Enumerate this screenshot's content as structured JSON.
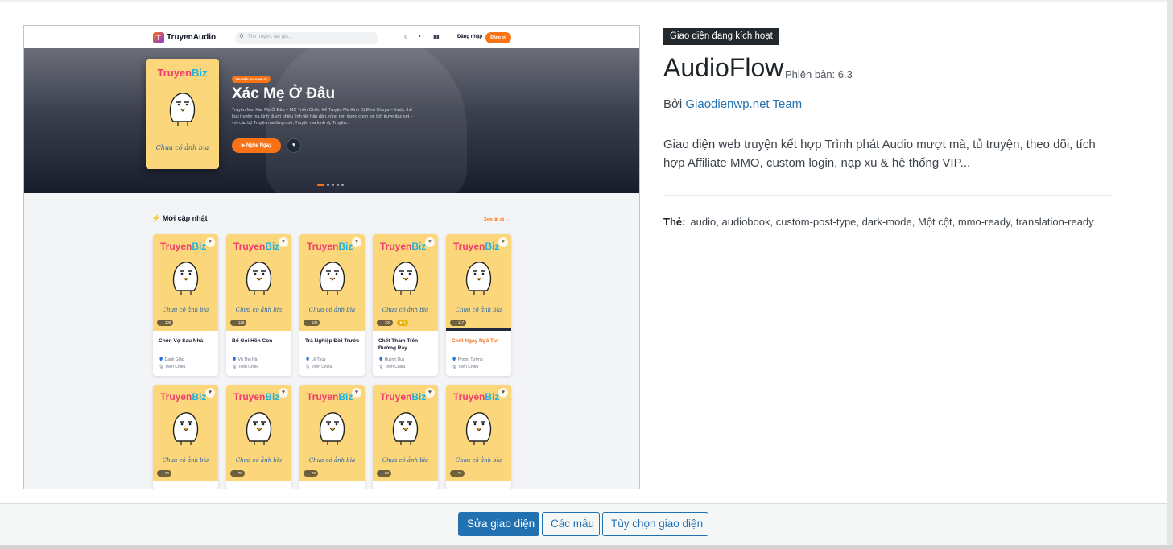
{
  "preview": {
    "site_brand": "TruyenAudio",
    "logo_letter": "T",
    "search_placeholder": "Tìm truyện, tác giả...",
    "login_label": "Đăng nhập",
    "register_label": "Đăng ký",
    "hero": {
      "badge": "TRUYỆN MA KINH DỊ",
      "title": "Xác Mẹ Ở Đâu",
      "description": "Truyện Ma: Xác Mẹ Ở Đâu – MC Triển Chiêu Kể Truyện Ma Kinh Dị Đêm Khuya – thuộc thể loại truyện ma kinh dị với nhiều tình tiết hấp dẫn, rùng rợn được chọn lọc bởi truyenbiz.net – với các bộ Truyện ma làng quê, Truyện ma kinh dị, Truyện...",
      "play_label": "Nghe Ngay",
      "cover_brand_a": "Truyen",
      "cover_brand_b": "Biz",
      "cover_caption": "Chưa có ảnh bìa"
    },
    "section_title": "Mới cập nhật",
    "see_all": "Xem tất cả",
    "cards": [
      {
        "title": "Chôn Vợ Sau Nhà",
        "author": "Danh Giác",
        "narrator": "Triển Chiêu",
        "listens": "109",
        "vip": ""
      },
      {
        "title": "Bố Gọi Hồn Con",
        "author": "Vũ Thu Hà",
        "narrator": "Triển Chiêu",
        "listens": "125",
        "vip": ""
      },
      {
        "title": "Trả Nghiệp Đời Trước",
        "author": "Lê Thủy",
        "narrator": "Triển Chiêu",
        "listens": "130",
        "vip": ""
      },
      {
        "title": "Chết Thảm Trên Đường Ray",
        "author": "Huỳnh Duy",
        "narrator": "Triển Chiêu",
        "listens": "102",
        "vip": "1"
      },
      {
        "title": "Chết Ngay Ngã Tư",
        "author": "Phong Tường",
        "narrator": "Triển Chiêu",
        "listens": "117",
        "vip": ""
      }
    ],
    "cards_row2": [
      {
        "listens": "78"
      },
      {
        "listens": "78"
      },
      {
        "listens": "73"
      },
      {
        "listens": "82"
      },
      {
        "listens": "71"
      }
    ]
  },
  "theme": {
    "active_badge": "Giao diện đang kích hoạt",
    "name": "AudioFlow",
    "version_label": "Phiên bản: 6.3",
    "by_label": "Bởi",
    "author": "Giaodienwp.net Team",
    "description": "Giao diện web truyện kết hợp Trình phát Audio mượt mà, tủ truyện, theo dõi, tích hợp Affiliate MMO, custom login, nạp xu & hệ thống VIP...",
    "tags_label": "Thẻ:",
    "tags": "audio, audiobook, custom-post-type, dark-mode, Một cột, mmo-ready, translation-ready"
  },
  "actions": {
    "customize": "Sửa giao diện",
    "templates": "Các mẫu",
    "options": "Tùy chọn giao diện"
  },
  "colors": {
    "primary": "#2271b1",
    "accent_orange": "#f97316",
    "cover_yellow": "#fcd67a"
  }
}
